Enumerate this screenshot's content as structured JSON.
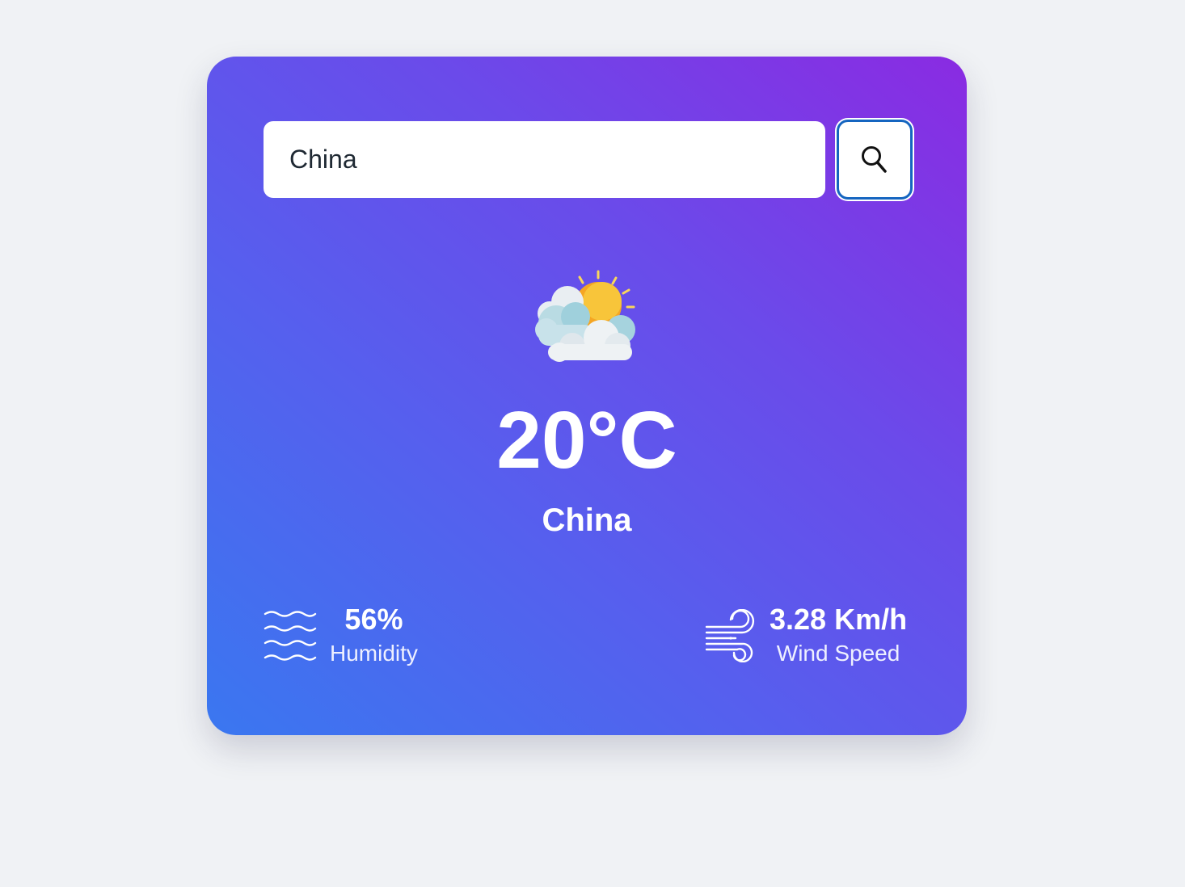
{
  "search": {
    "value": "China",
    "icon": "search-icon"
  },
  "weather": {
    "icon": "partly-cloudy-icon",
    "temperature": "20°C",
    "city": "China"
  },
  "humidity": {
    "icon": "humidity-waves-icon",
    "value": "56%",
    "label": "Humidity"
  },
  "wind": {
    "icon": "wind-icon",
    "value": "3.28 Km/h",
    "label": "Wind Speed"
  },
  "colors": {
    "background": "#f0f2f5",
    "gradient_start": "#8a2be2",
    "gradient_end": "#3a77f0",
    "button_border": "#1565c0"
  }
}
